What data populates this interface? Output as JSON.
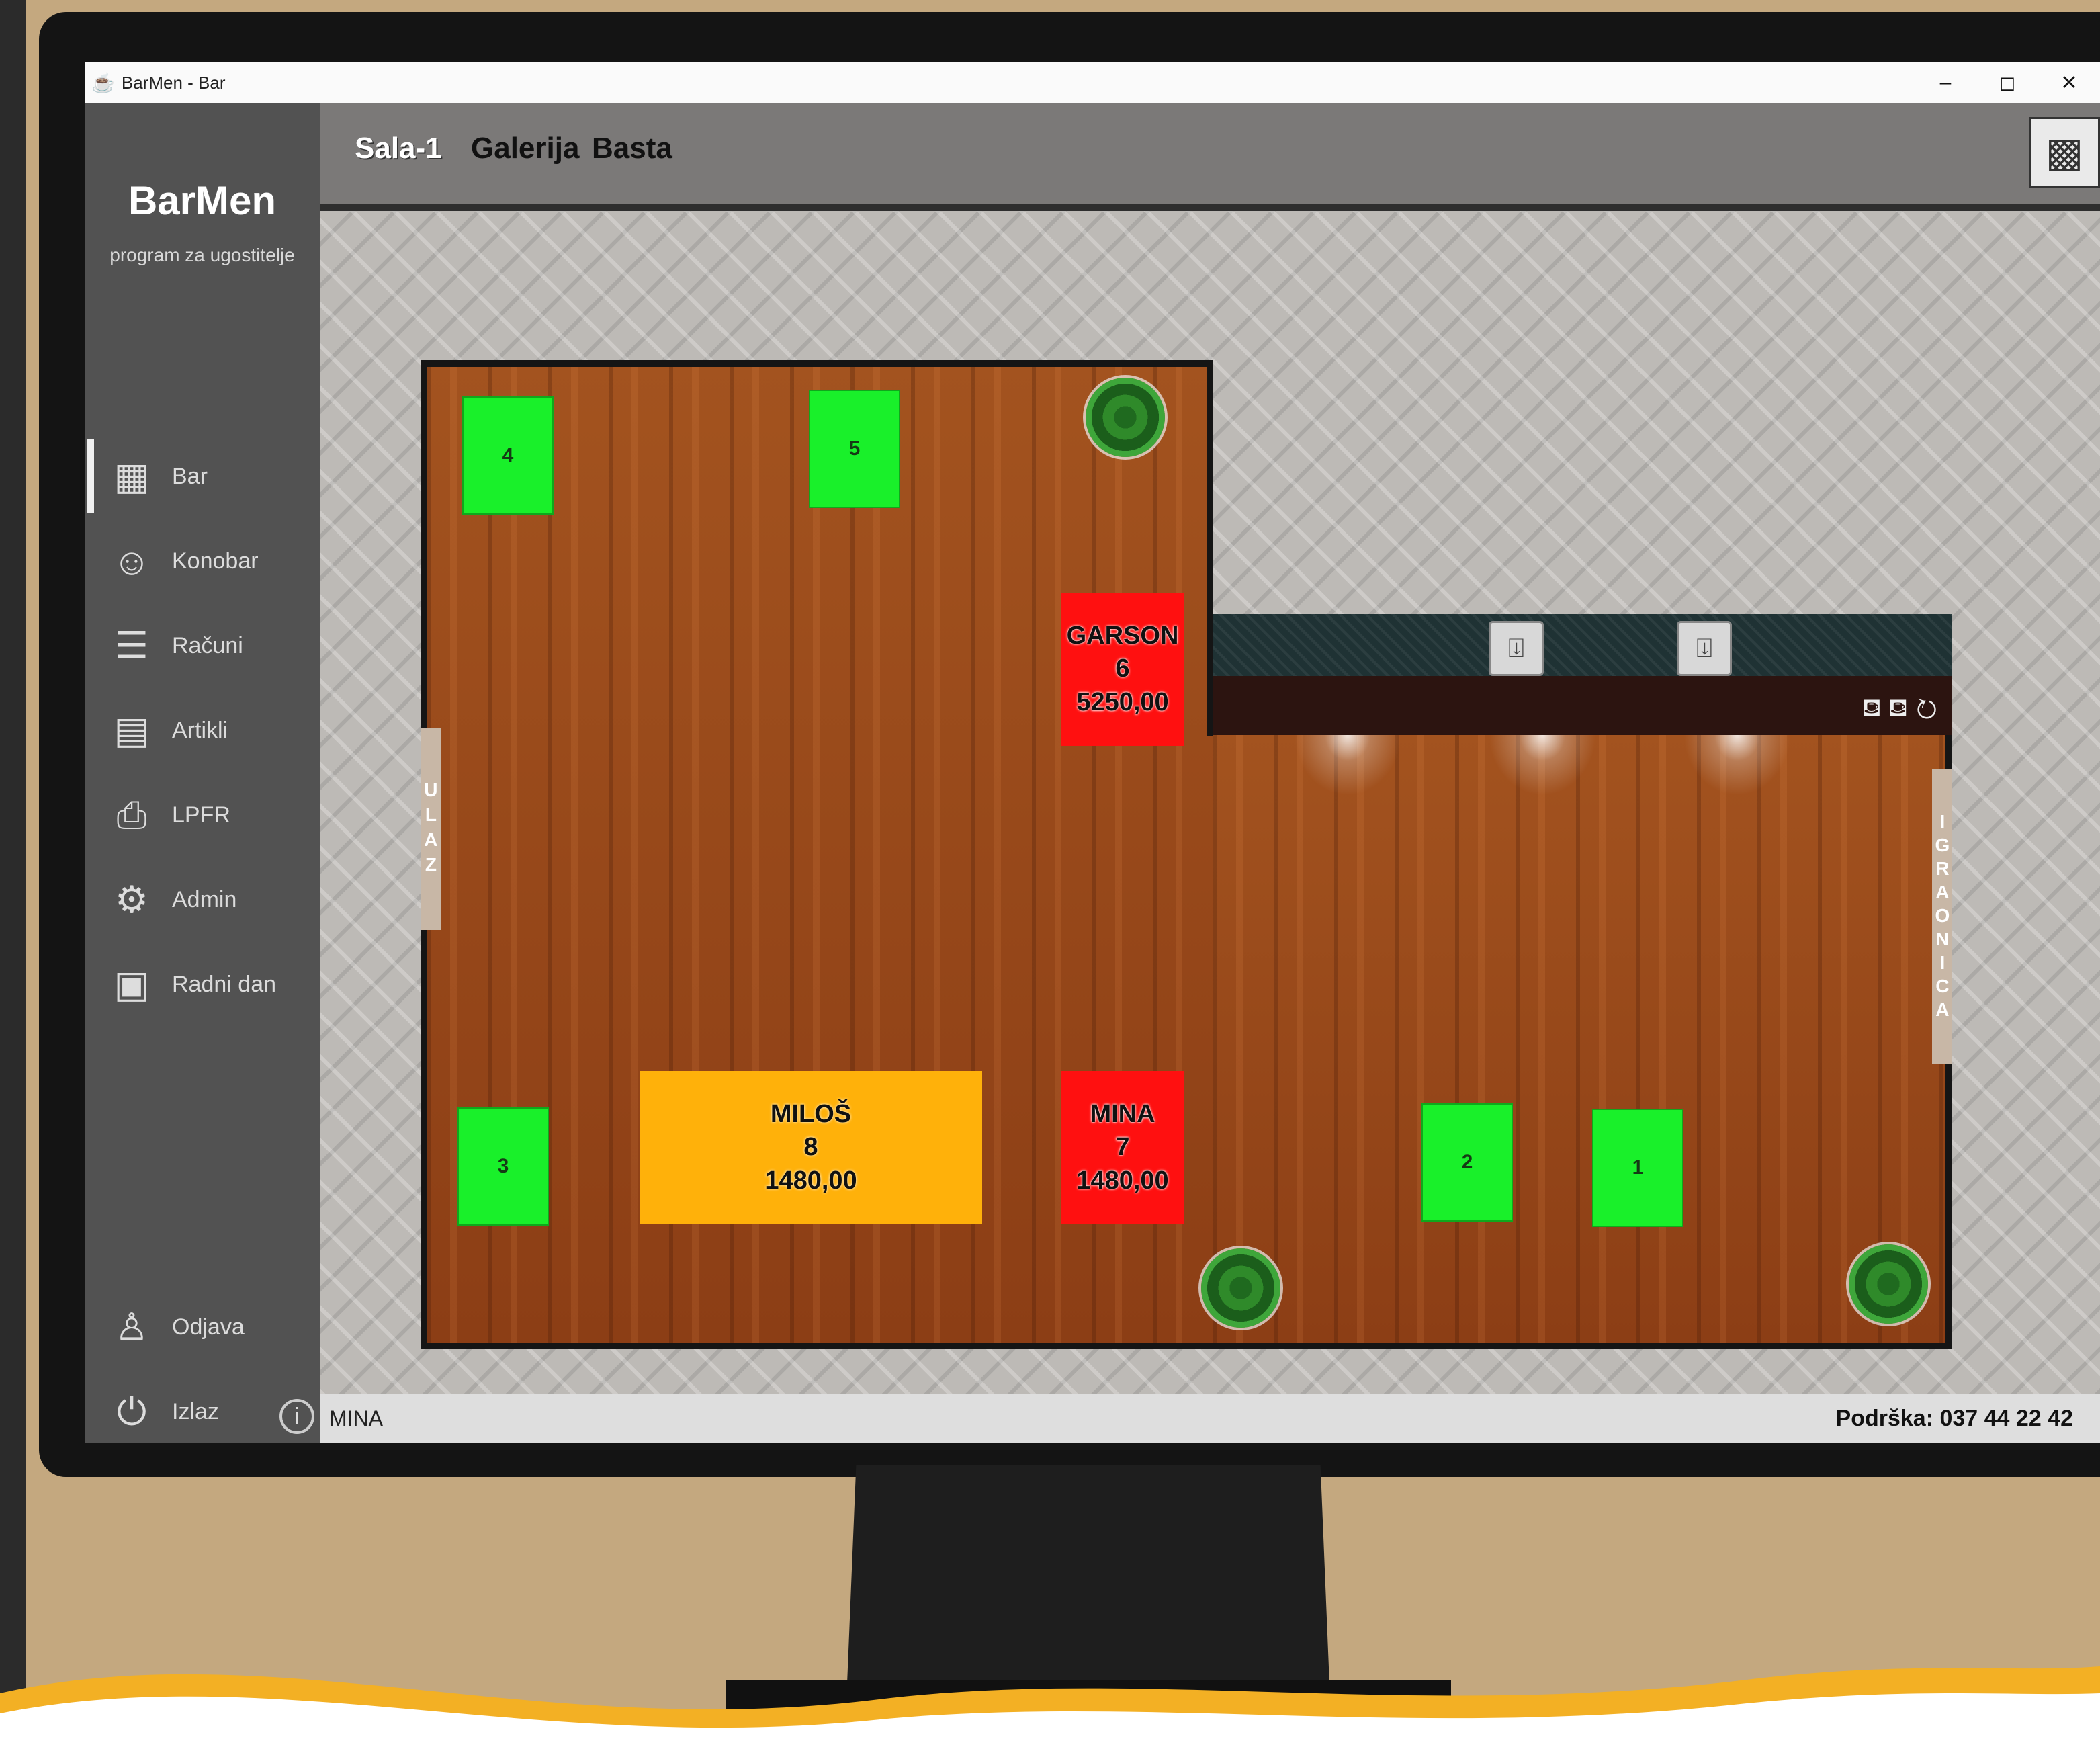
{
  "window": {
    "title": "BarMen - Bar",
    "controls": [
      "–",
      "◻",
      "✕"
    ]
  },
  "sidebar": {
    "brand": "BarMen",
    "subtitle": "program za ugostitelje",
    "items": [
      {
        "label": "Bar",
        "icon": "bar-icon",
        "active": true
      },
      {
        "label": "Konobar",
        "icon": "waiter-icon",
        "active": false
      },
      {
        "label": "Računi",
        "icon": "receipts-icon",
        "active": false
      },
      {
        "label": "Artikli",
        "icon": "articles-icon",
        "active": false
      },
      {
        "label": "LPFR",
        "icon": "fiscal-printer-icon",
        "active": false
      },
      {
        "label": "Admin",
        "icon": "admin-icon",
        "active": false
      },
      {
        "label": "Radni dan",
        "icon": "calendar-icon",
        "active": false
      }
    ],
    "bottom_items": [
      {
        "label": "Odjava",
        "icon": "logout-user-icon"
      },
      {
        "label": "Izlaz",
        "icon": "power-icon"
      }
    ]
  },
  "tabs": [
    {
      "label": "Sala-1",
      "active": true
    },
    {
      "label": "Galerija",
      "active": false
    },
    {
      "label": "Basta",
      "active": false
    }
  ],
  "floor": {
    "entrance_label": "ULAZ",
    "playroom_label": "IGRAONICA",
    "tables": [
      {
        "number": "4",
        "status": "free"
      },
      {
        "number": "5",
        "status": "free"
      },
      {
        "number": "3",
        "status": "free"
      },
      {
        "number": "2",
        "status": "free"
      },
      {
        "number": "1",
        "status": "free"
      },
      {
        "waiter": "GARSON",
        "number": "6",
        "amount": "5250,00",
        "status": "occupied"
      },
      {
        "waiter": "MILOŠ",
        "number": "8",
        "amount": "1480,00",
        "status": "occupied-other"
      },
      {
        "waiter": "MINA",
        "number": "7",
        "amount": "1480,00",
        "status": "occupied"
      }
    ],
    "colors": {
      "free": "#19f02a",
      "occupied": "#ff1010",
      "occupied_other": "#ffb10a"
    }
  },
  "statusbar": {
    "user": "MINA",
    "support": "Podrška: 037 44 22 42"
  }
}
